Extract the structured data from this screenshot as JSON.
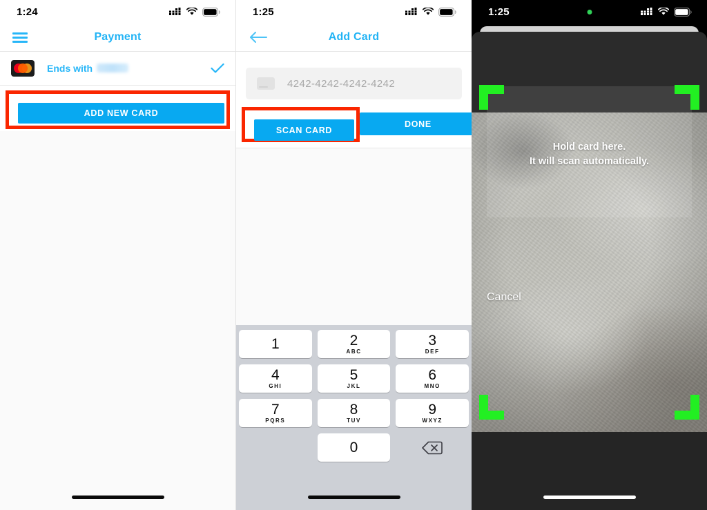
{
  "panels": {
    "payment": {
      "name": "payment-screen",
      "status_bar": {
        "time": "1:24",
        "icons": [
          "cellular-icon",
          "wifi-icon",
          "battery-icon"
        ]
      },
      "nav": {
        "menu_icon": "hamburger-menu-icon",
        "title": "Payment"
      },
      "saved_card": {
        "brand_icon": "mastercard-logo",
        "label": "Ends with",
        "masked_digits": "",
        "selected_icon": "checkmark-icon"
      },
      "add_card_button": "ADD NEW CARD",
      "highlight_color": "#fa2600"
    },
    "add_card": {
      "name": "add-card-screen",
      "status_bar": {
        "time": "1:25",
        "icons": [
          "cellular-icon",
          "wifi-icon",
          "battery-icon"
        ]
      },
      "nav": {
        "back_icon": "back-arrow-icon",
        "title": "Add Card"
      },
      "card_input": {
        "icon": "credit-card-icon",
        "placeholder": "4242-4242-4242-4242",
        "value": ""
      },
      "scan_button": "SCAN CARD",
      "done_button": "DONE",
      "keypad": {
        "rows": [
          [
            {
              "num": "1",
              "sub": ""
            },
            {
              "num": "2",
              "sub": "ABC"
            },
            {
              "num": "3",
              "sub": "DEF"
            }
          ],
          [
            {
              "num": "4",
              "sub": "GHI"
            },
            {
              "num": "5",
              "sub": "JKL"
            },
            {
              "num": "6",
              "sub": "MNO"
            }
          ],
          [
            {
              "num": "7",
              "sub": "PQRS"
            },
            {
              "num": "8",
              "sub": "TUV"
            },
            {
              "num": "9",
              "sub": "WXYZ"
            }
          ]
        ],
        "zero": {
          "num": "0",
          "sub": ""
        },
        "delete_icon": "backspace-icon"
      }
    },
    "scanner": {
      "name": "card-scanner-screen",
      "status_bar": {
        "time": "1:25",
        "recording_indicator": "green-dot-icon",
        "icons": [
          "cellular-icon",
          "wifi-icon",
          "battery-icon"
        ]
      },
      "overlay": {
        "line1": "Hold card here.",
        "line2": "It will scan automatically.",
        "bracket_color": "#22ef22"
      },
      "cancel_button": "Cancel"
    }
  },
  "colors": {
    "accent_blue": "#08a9f1",
    "title_blue": "#21b3f5",
    "highlight_red": "#fa2600",
    "scan_green": "#22ef22",
    "keyboard_bg": "#cdd0d6"
  }
}
